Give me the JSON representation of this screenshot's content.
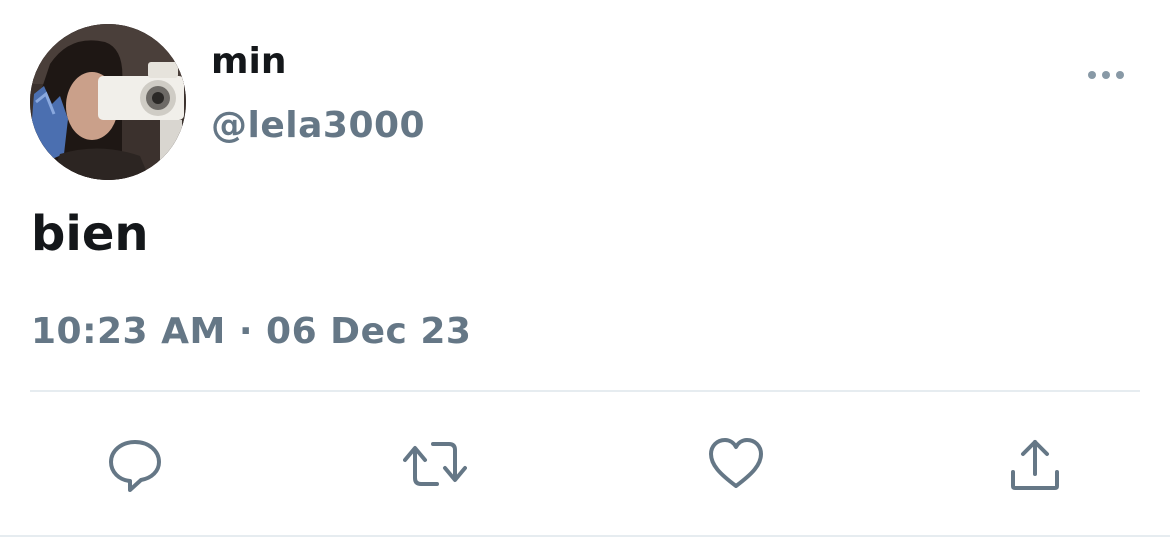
{
  "user": {
    "display_name": "min",
    "handle": "@lela3000",
    "avatar_icon": "avatar-photo"
  },
  "tweet": {
    "text": "bien",
    "timestamp": "10:23 AM · 06 Dec 23"
  },
  "actions": {
    "reply_icon": "reply-icon",
    "retweet_icon": "retweet-icon",
    "like_icon": "heart-icon",
    "share_icon": "share-icon",
    "more_icon": "more-icon"
  },
  "colors": {
    "primary_text": "#14171a",
    "secondary_text": "#657786",
    "divider": "#e6ecf0"
  }
}
